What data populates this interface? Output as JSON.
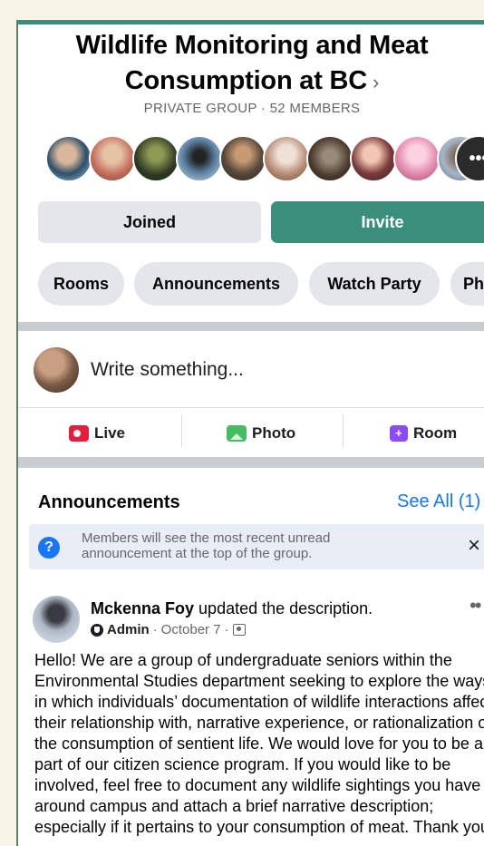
{
  "group": {
    "title": "Wildlife Monitoring and Meat Consumption at BC",
    "chevron": "›",
    "subtitle": "PRIVATE GROUP · 52 MEMBERS"
  },
  "members": {
    "more_label": "•••"
  },
  "buttons": {
    "joined": "Joined",
    "invite": "Invite"
  },
  "tabs": [
    {
      "label": "Rooms"
    },
    {
      "label": "Announcements"
    },
    {
      "label": "Watch Party"
    },
    {
      "label": "Ph"
    }
  ],
  "composer": {
    "placeholder": "Write something..."
  },
  "actions": [
    {
      "label": "Live",
      "icon": "live-icon",
      "color": "#e41e3f"
    },
    {
      "label": "Photo",
      "icon": "photo-icon",
      "color": "#45bd62"
    },
    {
      "label": "Room",
      "icon": "room-icon",
      "color": "#8c4cf3"
    }
  ],
  "announcements": {
    "title": "Announcements",
    "see_all": "See All (1)",
    "notice": "Members will see the most recent unread announcement at the top of the group.",
    "close": "×"
  },
  "post": {
    "author": "Mckenna Foy",
    "action": "updated the description.",
    "role": "Admin",
    "date": "October 7",
    "separator": "·",
    "more": "••",
    "body": "Hello! We are a group of undergraduate seniors within the Environmental Studies department seeking to explore the ways in which individuals’ documentation of wildlife interactions affects their relationship with, narrative experience, or rationalization of the consumption of sentient life. We would love for you to be a part of our citizen science program. If you would like to be involved, feel free to document any wildlife sightings you have around campus and attach a brief narrative description; especially if it pertains to your consumption of meat. Thank you!"
  },
  "colors": {
    "accent": "#3a8f7a",
    "link": "#1877f2"
  }
}
